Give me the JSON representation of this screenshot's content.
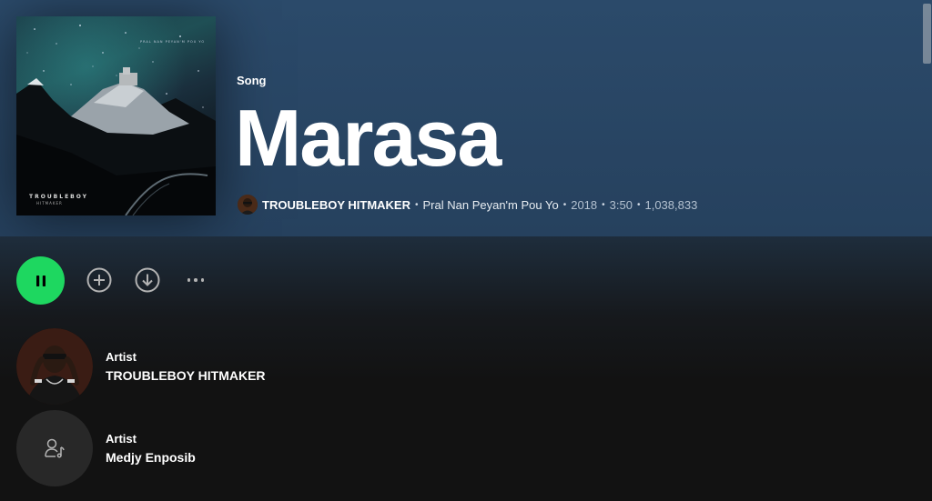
{
  "song": {
    "type_label": "Song",
    "title": "Marasa",
    "artist": "TROUBLEBOY HITMAKER",
    "album": "Pral Nan Peyan'm Pou Yo",
    "year": "2018",
    "duration": "3:50",
    "plays": "1,038,833",
    "separator": "•"
  },
  "cover": {
    "brand": "TROUBLEBOY",
    "sub": "HITMAKER",
    "top_text": "PRAL NAN PEYAN'M POU YO"
  },
  "controls": {
    "play_icon": "pause-icon",
    "add_icon": "add-circle-icon",
    "download_icon": "download-icon",
    "more_icon": "more-horizontal-icon"
  },
  "artists": [
    {
      "label": "Artist",
      "name": "TROUBLEBOY HITMAKER",
      "image": "artist-photo"
    },
    {
      "label": "Artist",
      "name": "Medjy Enposib",
      "image": "artist-placeholder-icon"
    }
  ],
  "colors": {
    "header_bg": "#2b4a6a",
    "play_green": "#1ed760",
    "background": "#121212"
  }
}
